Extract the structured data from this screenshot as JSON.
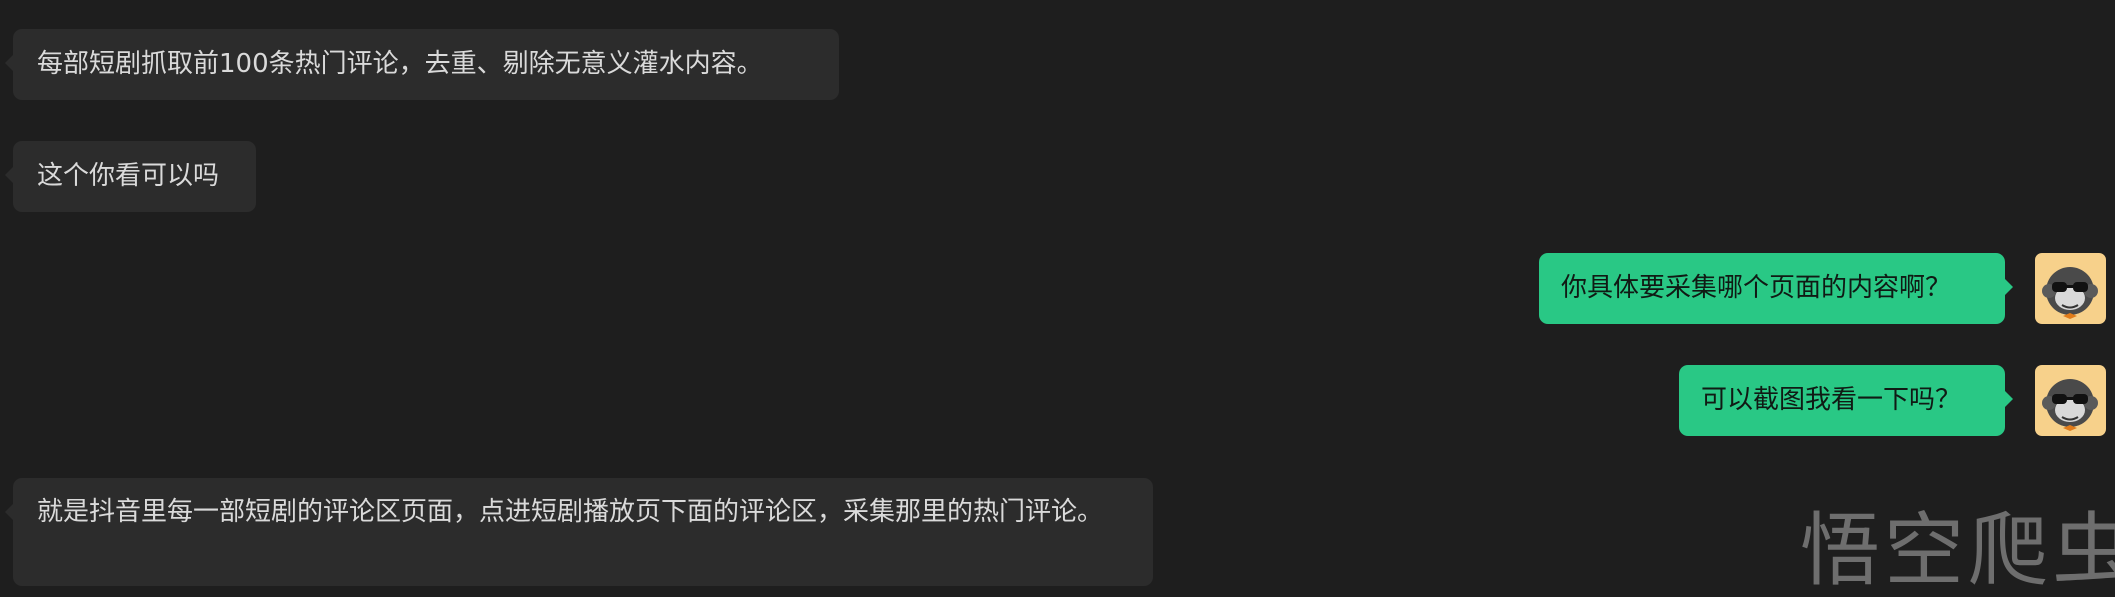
{
  "chat": {
    "messages": [
      {
        "side": "left",
        "text": "每部短剧抓取前100条热门评论，去重、剔除无意义灌水内容。"
      },
      {
        "side": "left",
        "text": "这个你看可以吗"
      },
      {
        "side": "right",
        "text": "你具体要采集哪个页面的内容啊？"
      },
      {
        "side": "right",
        "text": "可以截图我看一下吗？"
      },
      {
        "side": "left",
        "text": "就是抖音里每一部短剧的评论区页面，点进短剧播放页下面的评论区，采集那里的热门评论。"
      }
    ]
  },
  "watermark": {
    "text": "悟空爬虫"
  },
  "colors": {
    "background": "#1e1e1e",
    "incoming_bubble": "#2c2c2c",
    "outgoing_bubble": "#29c885",
    "avatar_bg": "#f7d18b"
  },
  "icons": {
    "avatar": "monkey-with-sunglasses-avatar-icon"
  }
}
